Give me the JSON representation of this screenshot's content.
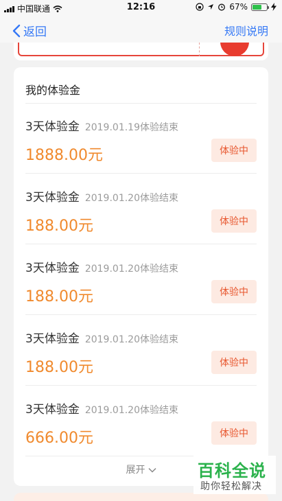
{
  "status_bar": {
    "carrier": "中国联通",
    "time": "12:16",
    "battery_percent": "67%",
    "battery_level": 0.67
  },
  "nav": {
    "back_label": "返回",
    "right_label": "规则说明"
  },
  "card": {
    "title": "我的体验金",
    "items": [
      {
        "name": "3天体验金",
        "date": "2019.01.19体验结束",
        "amount": "1888.00元",
        "status": "体验中"
      },
      {
        "name": "3天体验金",
        "date": "2019.01.20体验结束",
        "amount": "188.00元",
        "status": "体验中"
      },
      {
        "name": "3天体验金",
        "date": "2019.01.20体验结束",
        "amount": "188.00元",
        "status": "体验中"
      },
      {
        "name": "3天体验金",
        "date": "2019.01.20体验结束",
        "amount": "188.00元",
        "status": "体验中"
      },
      {
        "name": "3天体验金",
        "date": "2019.01.20体验结束",
        "amount": "666.00元",
        "status": "体验中"
      }
    ],
    "expand_label": "展开"
  },
  "watermark": {
    "title": "百科全说",
    "subtitle": "助你轻松解决"
  },
  "colors": {
    "accent_blue": "#3478f6",
    "amount_orange": "#f08a2e",
    "badge_bg": "#fdeae2",
    "badge_text": "#e8572f",
    "watermark_green": "#2bb24c"
  }
}
